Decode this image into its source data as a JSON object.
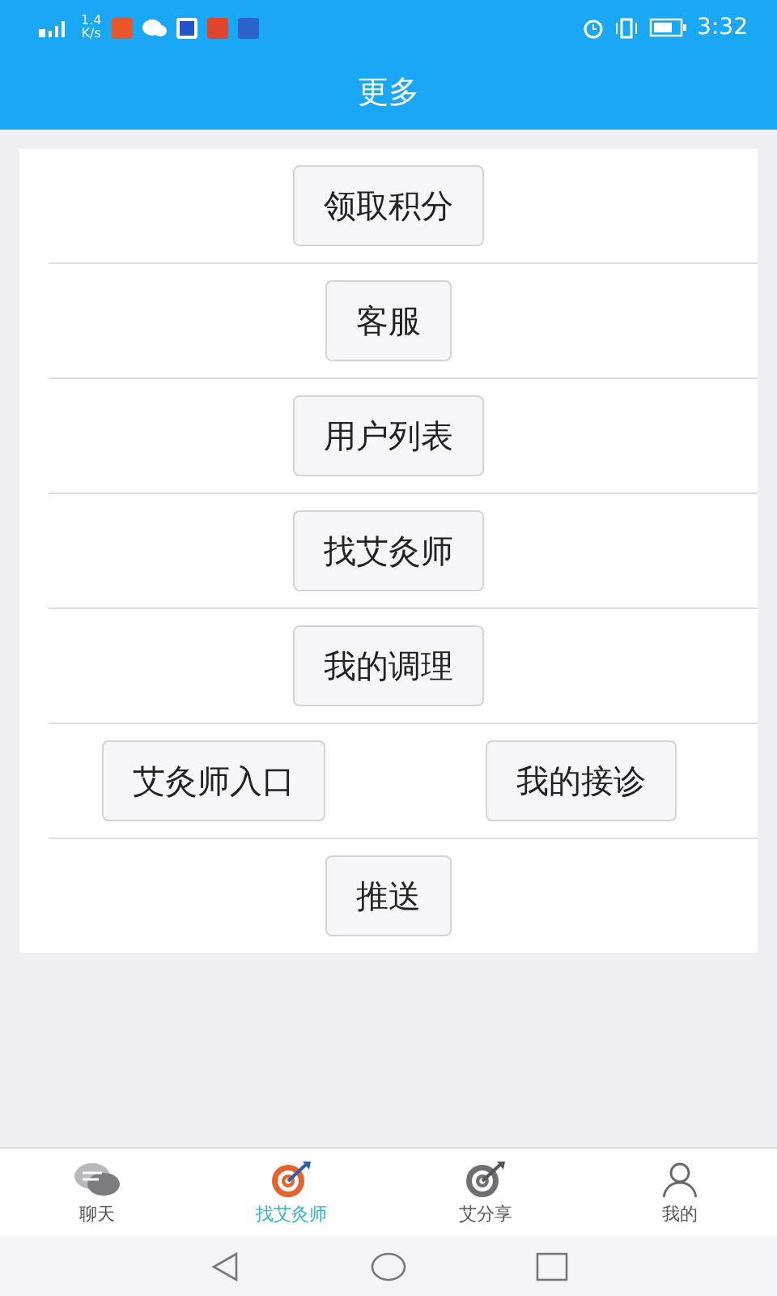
{
  "status_bar": {
    "speed": "1.4\nK/s",
    "time": "3:32"
  },
  "header": {
    "title": "更多"
  },
  "rows": [
    {
      "buttons": [
        "领取积分"
      ]
    },
    {
      "buttons": [
        "客服"
      ]
    },
    {
      "buttons": [
        "用户列表"
      ]
    },
    {
      "buttons": [
        "找艾灸师"
      ]
    },
    {
      "buttons": [
        "我的调理"
      ]
    },
    {
      "buttons": [
        "艾灸师入口",
        "我的接诊"
      ]
    },
    {
      "buttons": [
        "推送"
      ]
    }
  ],
  "tabs": [
    {
      "label": "聊天",
      "kind": "chat",
      "selected": false
    },
    {
      "label": "找艾灸师",
      "kind": "target",
      "selected": true
    },
    {
      "label": "艾分享",
      "kind": "target",
      "selected": false
    },
    {
      "label": "我的",
      "kind": "person",
      "selected": false
    }
  ]
}
